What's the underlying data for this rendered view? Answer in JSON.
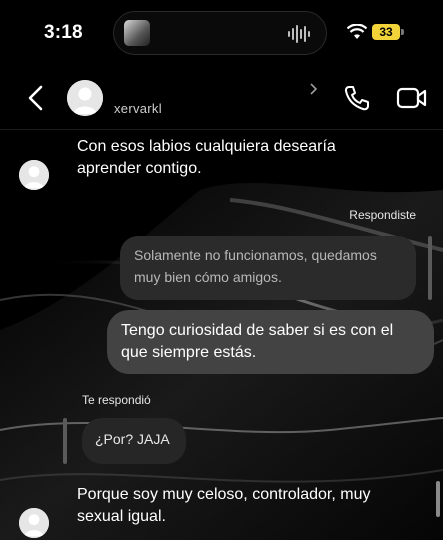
{
  "status_bar": {
    "time": "3:18",
    "battery": "33"
  },
  "header": {
    "username": "xervarkl"
  },
  "messages": {
    "m1": "Con esos labios cualquiera desearía aprender contigo.",
    "reply_label_out": "Respondiste",
    "quoted_out": "Solamente no funcionamos, quedamos muy bien cómo amigos.",
    "m2": "Tengo curiosidad de saber si es con el que siempre estás.",
    "reply_label_in": "Te respondió",
    "quoted_in": "¿Por? JAJA",
    "m3": "Porque soy muy celoso, controlador, muy sexual igual."
  },
  "colors": {
    "battery": "#f3d33a",
    "bubble_out": "#434343",
    "quoted_bubble": "#2b2b2b"
  },
  "icons": [
    "back-arrow-icon",
    "avatar-icon",
    "chevron-right-icon",
    "phone-icon",
    "video-camera-icon",
    "wifi-icon",
    "sound-wave-icon"
  ]
}
